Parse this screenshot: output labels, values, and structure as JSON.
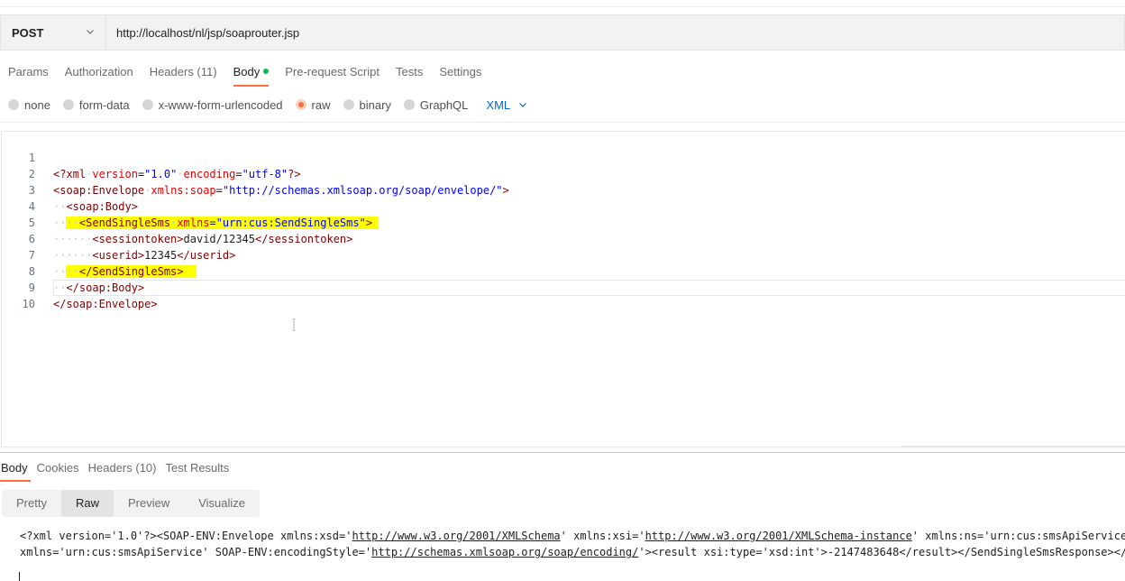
{
  "request": {
    "method": "POST",
    "url": "http://localhost/nl/jsp/soaprouter.jsp"
  },
  "request_tabs": [
    {
      "label": "Params",
      "active": false
    },
    {
      "label": "Authorization",
      "active": false
    },
    {
      "label": "Headers (11)",
      "active": false
    },
    {
      "label": "Body",
      "active": true,
      "indicator_color": "#0cbb52"
    },
    {
      "label": "Pre-request Script",
      "active": false
    },
    {
      "label": "Tests",
      "active": false
    },
    {
      "label": "Settings",
      "active": false
    }
  ],
  "body_types": [
    {
      "label": "none",
      "checked": false
    },
    {
      "label": "form-data",
      "checked": false
    },
    {
      "label": "x-www-form-urlencoded",
      "checked": false
    },
    {
      "label": "raw",
      "checked": true
    },
    {
      "label": "binary",
      "checked": false
    },
    {
      "label": "GraphQL",
      "checked": false
    }
  ],
  "raw_language": "XML",
  "editor": {
    "line_numbers": [
      "1",
      "2",
      "3",
      "4",
      "5",
      "6",
      "7",
      "8",
      "9",
      "10"
    ],
    "lines": [
      "<?xml version=\"1.0\" encoding=\"utf-8\"?>",
      "<soap:Envelope xmlns:soap=\"http://schemas.xmlsoap.org/soap/envelope/\">",
      "  <soap:Body>",
      "    <SendSingleSms xmlns=\"urn:cus:SendSingleSms\">",
      "      <sessiontoken>david/12345</sessiontoken>",
      "      <userid>12345</userid>",
      "    </SendSingleSms>",
      "  </soap:Body>",
      "</soap:Envelope>",
      ""
    ]
  },
  "response_tabs": [
    {
      "label": "Body",
      "active": true
    },
    {
      "label": "Cookies",
      "active": false
    },
    {
      "label": "Headers (10)",
      "active": false
    },
    {
      "label": "Test Results",
      "active": false
    }
  ],
  "view_modes": [
    {
      "label": "Pretty",
      "active": false
    },
    {
      "label": "Raw",
      "active": true
    },
    {
      "label": "Preview",
      "active": false
    },
    {
      "label": "Visualize",
      "active": false
    }
  ],
  "response_body": {
    "line1": "<?xml version='1.0'?><SOAP-ENV:Envelope xmlns:xsd='http://www.w3.org/2001/XMLSchema' xmlns:xsi='http://www.w3.org/2001/XMLSchema-instance' xmlns:ns='urn:cus:smsApiService",
    "line2": "xmlns='urn:cus:smsApiService' SOAP-ENV:encodingStyle='http://schemas.xmlsoap.org/soap/encoding/'><result xsi:type='xsd:int'>-2147483648</result></SendSingleSmsResponse></S"
  },
  "colors": {
    "accent": "#ff6c37",
    "link_blue": "#0265d2",
    "highlight": "#ffff00"
  }
}
